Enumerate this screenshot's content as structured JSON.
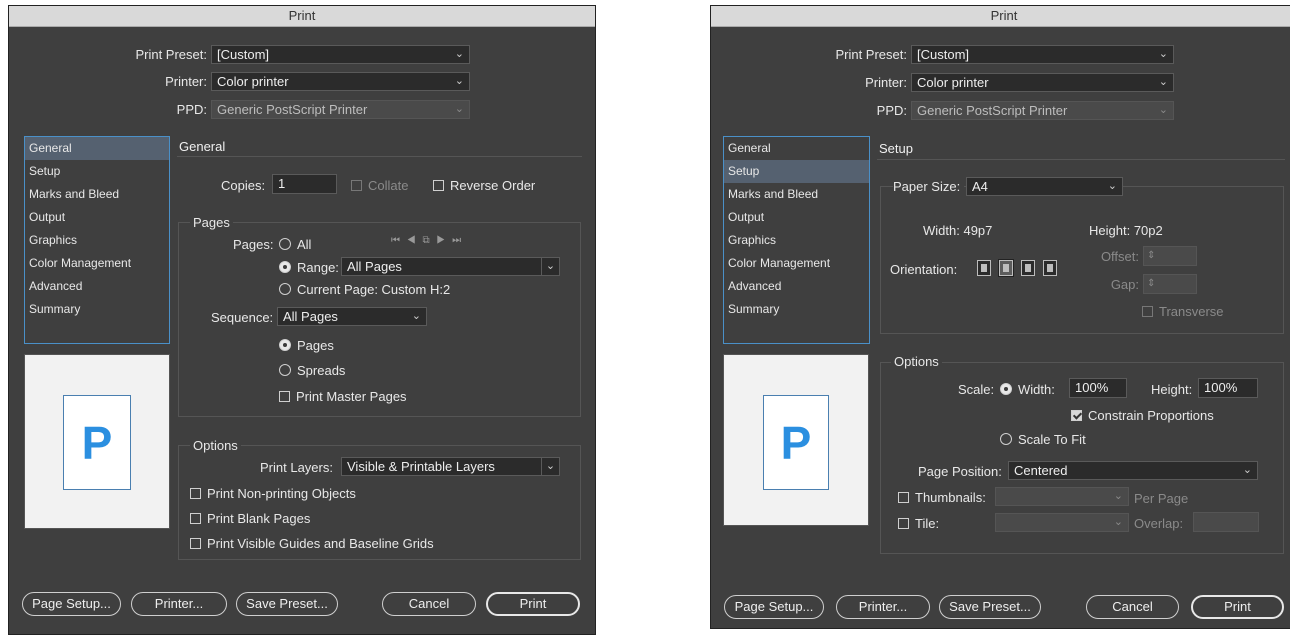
{
  "common": {
    "title": "Print",
    "print_preset_label": "Print Preset:",
    "print_preset_value": "[Custom]",
    "printer_label": "Printer:",
    "printer_value": "Color printer",
    "ppd_label": "PPD:",
    "ppd_value": "Generic PostScript Printer",
    "nav_items": [
      "General",
      "Setup",
      "Marks and Bleed",
      "Output",
      "Graphics",
      "Color Management",
      "Advanced",
      "Summary"
    ],
    "buttons": {
      "page_setup": "Page Setup...",
      "printer": "Printer...",
      "save_preset": "Save Preset...",
      "cancel": "Cancel",
      "print": "Print"
    },
    "preview_glyph": "P"
  },
  "left": {
    "section_title": "General",
    "copies_label": "Copies:",
    "copies_value": "1",
    "collate": "Collate",
    "reverse_order": "Reverse Order",
    "pages_group": "Pages",
    "pages_label": "Pages:",
    "all": "All",
    "page_nav": "⏮ ◀ ⧉ ▶ ⏭",
    "range_label": "Range:",
    "range_value": "All Pages",
    "current_page": "Current Page: Custom H:2",
    "sequence_label": "Sequence:",
    "sequence_value": "All Pages",
    "opt_pages": "Pages",
    "opt_spreads": "Spreads",
    "print_master_pages": "Print Master Pages",
    "options_group": "Options",
    "print_layers_label": "Print Layers:",
    "print_layers_value": "Visible & Printable Layers",
    "non_printing": "Print Non-printing Objects",
    "blank_pages": "Print Blank Pages",
    "visible_guides": "Print Visible Guides and Baseline Grids"
  },
  "right": {
    "section_title": "Setup",
    "paper_size_label": "Paper Size:",
    "paper_size_value": "A4",
    "width_label": "Width:",
    "width_value": "49p7",
    "height_label": "Height:",
    "height_value": "70p2",
    "offset_label": "Offset:",
    "gap_label": "Gap:",
    "orientation_label": "Orientation:",
    "transverse": "Transverse",
    "options_group": "Options",
    "scale_label": "Scale:",
    "scale_width_label": "Width:",
    "scale_width_value": "100%",
    "scale_height_label": "Height:",
    "scale_height_value": "100%",
    "constrain": "Constrain Proportions",
    "scale_to_fit": "Scale To Fit",
    "page_position_label": "Page Position:",
    "page_position_value": "Centered",
    "thumbnails": "Thumbnails:",
    "per_page": "Per Page",
    "tile": "Tile:",
    "overlap": "Overlap:"
  }
}
